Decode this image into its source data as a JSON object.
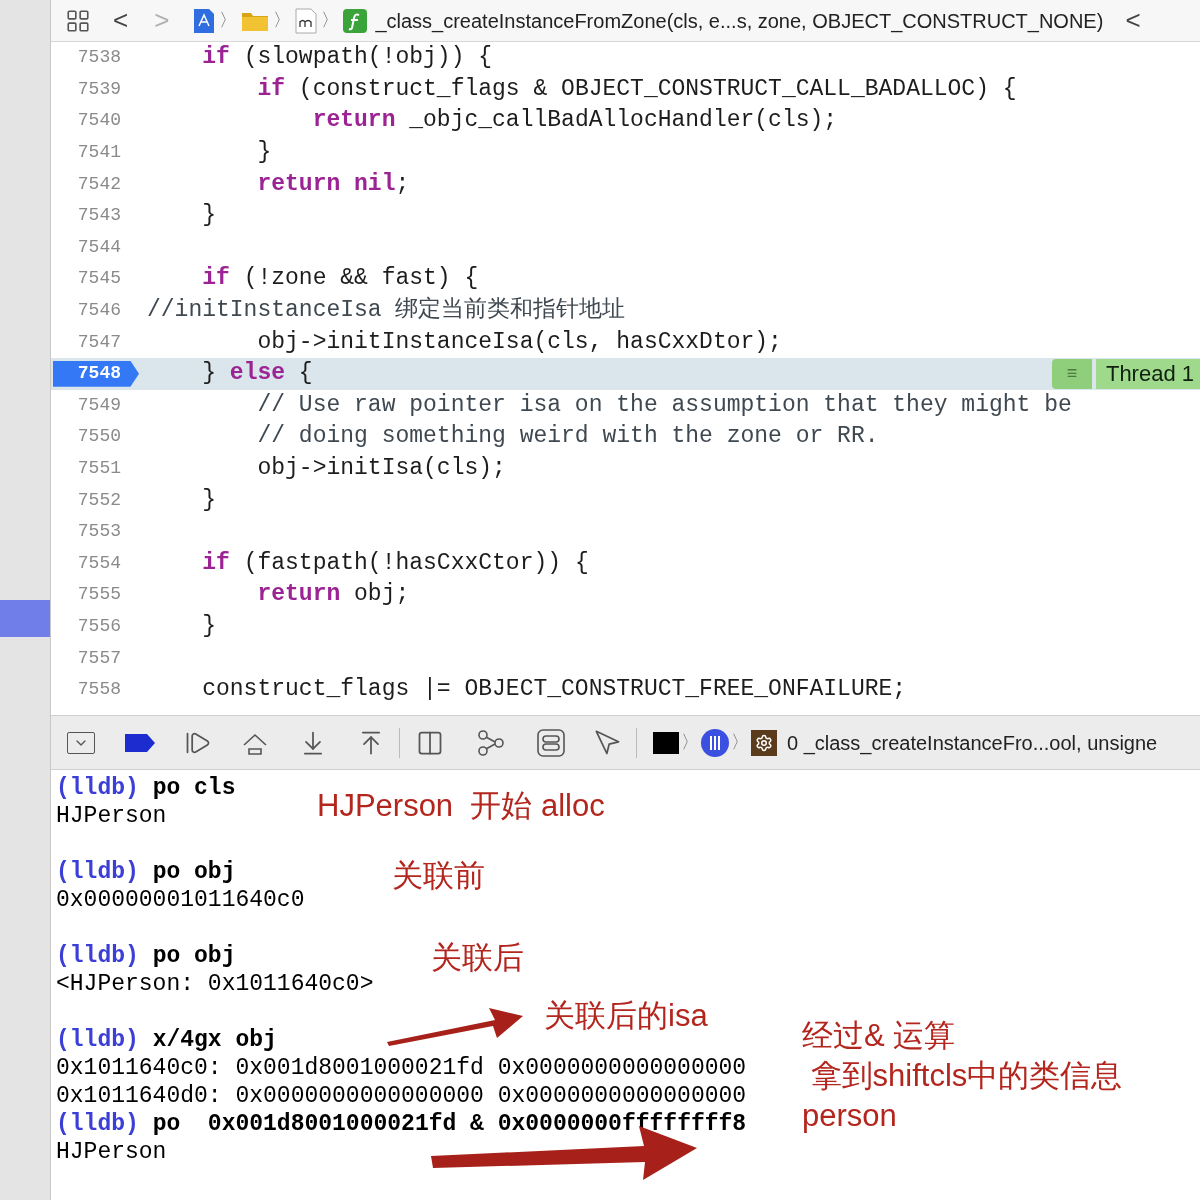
{
  "breadcrumb": {
    "back": "<",
    "forward": ">",
    "path_separator": "〉",
    "function": "_class_createInstanceFromZone(cls, e...s, zone, OBJECT_CONSTRUCT_NONE)",
    "trailing": "<"
  },
  "code_lines": [
    {
      "number": "7538",
      "selected": false,
      "segments": [
        {
          "kind": "keyword",
          "text": "    if"
        },
        {
          "kind": "plain",
          "text": " (slowpath(!obj)) {"
        }
      ]
    },
    {
      "number": "7539",
      "selected": false,
      "segments": [
        {
          "kind": "keyword",
          "text": "        if"
        },
        {
          "kind": "plain",
          "text": " (construct_flags & OBJECT_CONSTRUCT_CALL_BADALLOC) {"
        }
      ]
    },
    {
      "number": "7540",
      "selected": false,
      "segments": [
        {
          "kind": "keyword",
          "text": "            return"
        },
        {
          "kind": "plain",
          "text": " _objc_callBadAllocHandler(cls);"
        }
      ]
    },
    {
      "number": "7541",
      "selected": false,
      "segments": [
        {
          "kind": "plain",
          "text": "        }"
        }
      ]
    },
    {
      "number": "7542",
      "selected": false,
      "segments": [
        {
          "kind": "keyword",
          "text": "        return nil"
        },
        {
          "kind": "plain",
          "text": ";"
        }
      ]
    },
    {
      "number": "7543",
      "selected": false,
      "segments": [
        {
          "kind": "plain",
          "text": "    }"
        }
      ]
    },
    {
      "number": "7544",
      "selected": false
    },
    {
      "number": "7545",
      "selected": false,
      "segments": [
        {
          "kind": "keyword",
          "text": "    if"
        },
        {
          "kind": "plain",
          "text": " (!zone && fast) {"
        }
      ]
    },
    {
      "number": "7546",
      "selected": false,
      "segments": [
        {
          "kind": "comment",
          "text": "//initInstanceIsa 绑定当前类和指针地址"
        }
      ]
    },
    {
      "number": "7547",
      "selected": false,
      "segments": [
        {
          "kind": "plain",
          "text": "        obj->initInstanceIsa(cls, hasCxxDtor);"
        }
      ]
    },
    {
      "number": "7548",
      "selected": true,
      "segments": [
        {
          "kind": "plain",
          "text": "    } "
        },
        {
          "kind": "keyword",
          "text": "else"
        },
        {
          "kind": "plain",
          "text": " {"
        }
      ]
    },
    {
      "number": "7549",
      "selected": false,
      "segments": [
        {
          "kind": "comment",
          "text": "        // Use raw pointer isa on the assumption that they might be"
        }
      ]
    },
    {
      "number": "7550",
      "selected": false,
      "segments": [
        {
          "kind": "comment",
          "text": "        // doing something weird with the zone or RR."
        }
      ]
    },
    {
      "number": "7551",
      "selected": false,
      "segments": [
        {
          "kind": "plain",
          "text": "        obj->initIsa(cls);"
        }
      ]
    },
    {
      "number": "7552",
      "selected": false,
      "segments": [
        {
          "kind": "plain",
          "text": "    }"
        }
      ]
    },
    {
      "number": "7553",
      "selected": false
    },
    {
      "number": "7554",
      "selected": false,
      "segments": [
        {
          "kind": "keyword",
          "text": "    if"
        },
        {
          "kind": "plain",
          "text": " (fastpath(!hasCxxCtor)) {"
        }
      ]
    },
    {
      "number": "7555",
      "selected": false,
      "segments": [
        {
          "kind": "keyword",
          "text": "        return"
        },
        {
          "kind": "plain",
          "text": " obj;"
        }
      ]
    },
    {
      "number": "7556",
      "selected": false,
      "segments": [
        {
          "kind": "plain",
          "text": "    }"
        }
      ]
    },
    {
      "number": "7557",
      "selected": false
    },
    {
      "number": "7558",
      "selected": false,
      "segments": [
        {
          "kind": "plain",
          "text": "    construct_flags |= OBJECT_CONSTRUCT_FREE_ONFAILURE;"
        }
      ]
    }
  ],
  "thread_label": {
    "menu": "≡",
    "text": "Thread 1"
  },
  "debug_bar": {
    "separator": "〉",
    "frame": "0 _class_createInstanceFro...ool, unsigne"
  },
  "console_lines": [
    {
      "kind": "command",
      "prompt": "(lldb)",
      "command": "po cls"
    },
    {
      "kind": "output",
      "text": "HJPerson"
    },
    {
      "kind": "blank"
    },
    {
      "kind": "command",
      "prompt": "(lldb)",
      "command": "po obj"
    },
    {
      "kind": "output",
      "text": "0x00000001011640c0"
    },
    {
      "kind": "blank"
    },
    {
      "kind": "command",
      "prompt": "(lldb)",
      "command": "po obj"
    },
    {
      "kind": "output",
      "text": "<HJPerson: 0x1011640c0>"
    },
    {
      "kind": "blank"
    },
    {
      "kind": "command",
      "prompt": "(lldb)",
      "command": "x/4gx obj"
    },
    {
      "kind": "output",
      "text": "0x1011640c0: 0x001d8001000021fd 0x0000000000000000"
    },
    {
      "kind": "output",
      "text": "0x1011640d0: 0x0000000000000000 0x0000000000000000"
    },
    {
      "kind": "command",
      "prompt": "(lldb)",
      "command": "po  0x001d8001000021fd & 0x0000000ffffffff8"
    },
    {
      "kind": "output",
      "text": "HJPerson"
    },
    {
      "kind": "blank"
    }
  ],
  "annotations": [
    {
      "kind": "text",
      "text": "HJPerson  开始 alloc"
    },
    {
      "kind": "text",
      "text": "关联前"
    },
    {
      "kind": "text",
      "text": "关联后"
    },
    {
      "kind": "arrow"
    },
    {
      "kind": "text",
      "text": "关联后的isa"
    },
    {
      "kind": "text",
      "text": "经过& 运算"
    },
    {
      "kind": "text",
      "text": " 拿到shiftcls中的类信息"
    },
    {
      "kind": "text",
      "text": "person"
    },
    {
      "kind": "arrow"
    }
  ]
}
